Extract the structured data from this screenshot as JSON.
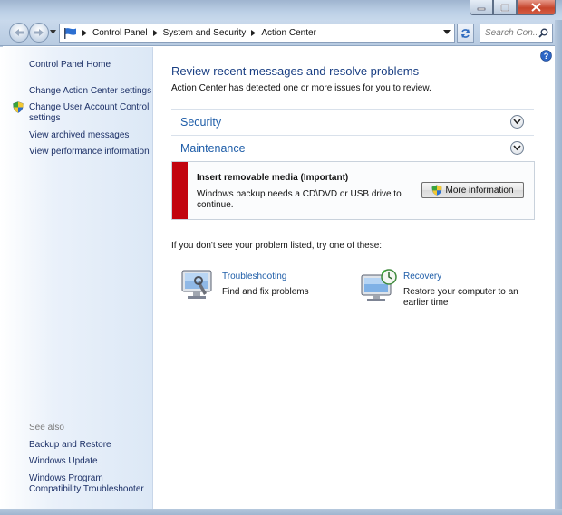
{
  "window": {
    "controls": [
      "minimize",
      "maximize",
      "close"
    ]
  },
  "address_bar": {
    "breadcrumbs": [
      "Control Panel",
      "System and Security",
      "Action Center"
    ]
  },
  "search": {
    "placeholder": "Search Con..."
  },
  "sidebar": {
    "links": [
      {
        "label": "Control Panel Home"
      },
      {
        "label": "Change Action Center settings"
      },
      {
        "label": "Change User Account Control settings",
        "icon": "uac-shield-icon"
      },
      {
        "label": "View archived messages"
      },
      {
        "label": "View performance information"
      }
    ],
    "see_also_heading": "See also",
    "see_also": [
      {
        "label": "Backup and Restore"
      },
      {
        "label": "Windows Update"
      },
      {
        "label": "Windows Program Compatibility Troubleshooter"
      }
    ]
  },
  "main": {
    "headline": "Review recent messages and resolve problems",
    "subtext": "Action Center has detected one or more issues for you to review.",
    "sections": [
      {
        "title": "Security",
        "expanded": false
      },
      {
        "title": "Maintenance",
        "expanded": true
      }
    ],
    "alert": {
      "title": "Insert removable media (Important)",
      "body": "Windows backup needs a CD\\DVD or USB drive to continue.",
      "button_label": "More information",
      "severity_color": "#c2040f"
    },
    "try_line": "If you don't see your problem listed, try one of these:",
    "tools": [
      {
        "title": "Troubleshooting",
        "description": "Find and fix problems",
        "icon": "troubleshooting-icon"
      },
      {
        "title": "Recovery",
        "description": "Restore your computer to an earlier time",
        "icon": "recovery-icon"
      }
    ]
  },
  "colors": {
    "link_blue": "#1e5da8",
    "headline_blue": "#1a3f83",
    "sidebar_link": "#1b2f66"
  }
}
